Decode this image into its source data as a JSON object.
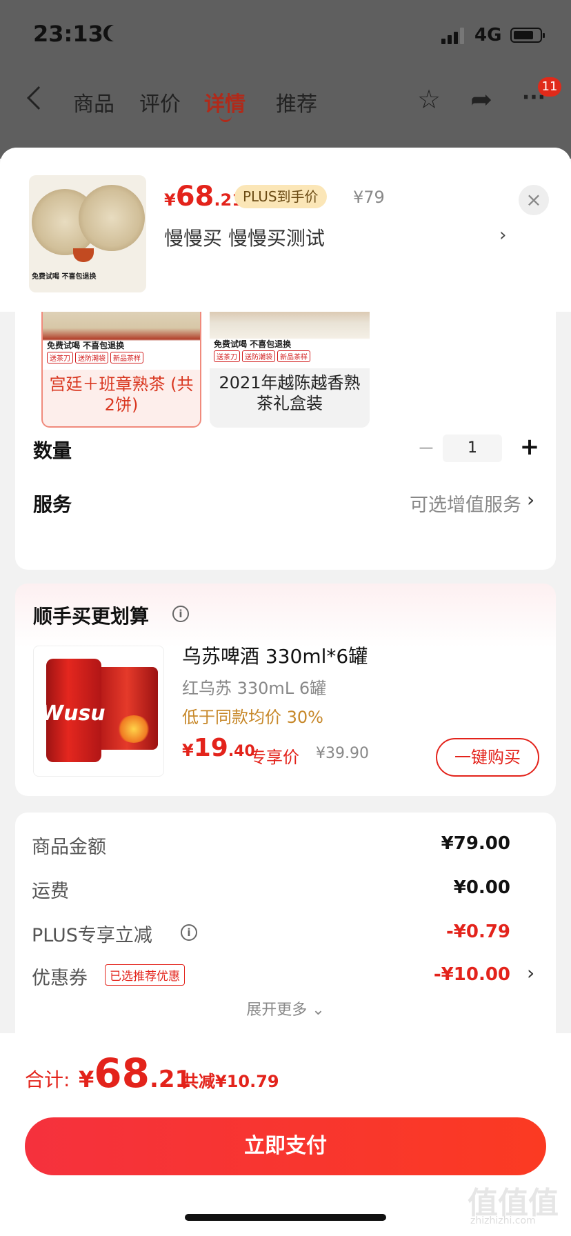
{
  "status_bar": {
    "time": "23:13",
    "network": "4G"
  },
  "top_nav": {
    "tabs": [
      "商品",
      "评价",
      "详情",
      "推荐"
    ],
    "active_tab": "详情",
    "badge_count": "11"
  },
  "header": {
    "price_currency": "¥",
    "price_int": "68",
    "price_dec": ".21",
    "plus_tag": "PLUS到手价",
    "original_price": "¥79",
    "selection": "慢慢买  慢慢买测试",
    "close": "×",
    "thumb_text": "免费试喝 不喜包退换"
  },
  "variants": [
    {
      "label": "宫廷＋班章熟茶 (共2饼)",
      "strip": "免费试喝 不喜包退换",
      "tags": [
        "送茶刀",
        "送防潮袋",
        "新品茶样"
      ],
      "selected": true
    },
    {
      "label": "2021年越陈越香熟茶礼盒装",
      "strip": "免费试喝 不喜包退换",
      "tags": [
        "送茶刀",
        "送防潮袋",
        "新品茶样"
      ],
      "selected": false
    }
  ],
  "quantity": {
    "label": "数量",
    "value": "1",
    "minus": "−",
    "plus": "+"
  },
  "service": {
    "label": "服务",
    "value": "可选增值服务"
  },
  "deal": {
    "title": "顺手买更划算",
    "product_name": "乌苏啤酒 330ml*6罐",
    "spec": "红乌苏 330mL 6罐",
    "note": "低于同款均价 30%",
    "price_currency": "¥",
    "price_int": "19",
    "price_dec": ".40",
    "exclusive": "专享价",
    "original_price": "¥39.90",
    "buy_button": "一键购买",
    "logo": "Wusu"
  },
  "summary": {
    "rows": [
      {
        "label": "商品金额",
        "value": "¥79.00"
      },
      {
        "label": "运费",
        "value": "¥0.00"
      },
      {
        "label": "PLUS专享立减",
        "value": "-¥0.79"
      },
      {
        "label": "优惠券",
        "value": "-¥10.00"
      }
    ],
    "coupon_tag": "已选推荐优惠",
    "expand": "展开更多 ⌄"
  },
  "footer": {
    "total_label": "合计:",
    "total_currency": "¥",
    "total_int": "68",
    "total_dec": ".21",
    "total_save": "共减¥10.79",
    "pay_button": "立即支付",
    "watermark": "值值值",
    "watermark_sub": "zhizhizhi.com"
  },
  "colors": {
    "accent": "#e3231b",
    "plus_tag_bg": "#fbe6b7"
  }
}
